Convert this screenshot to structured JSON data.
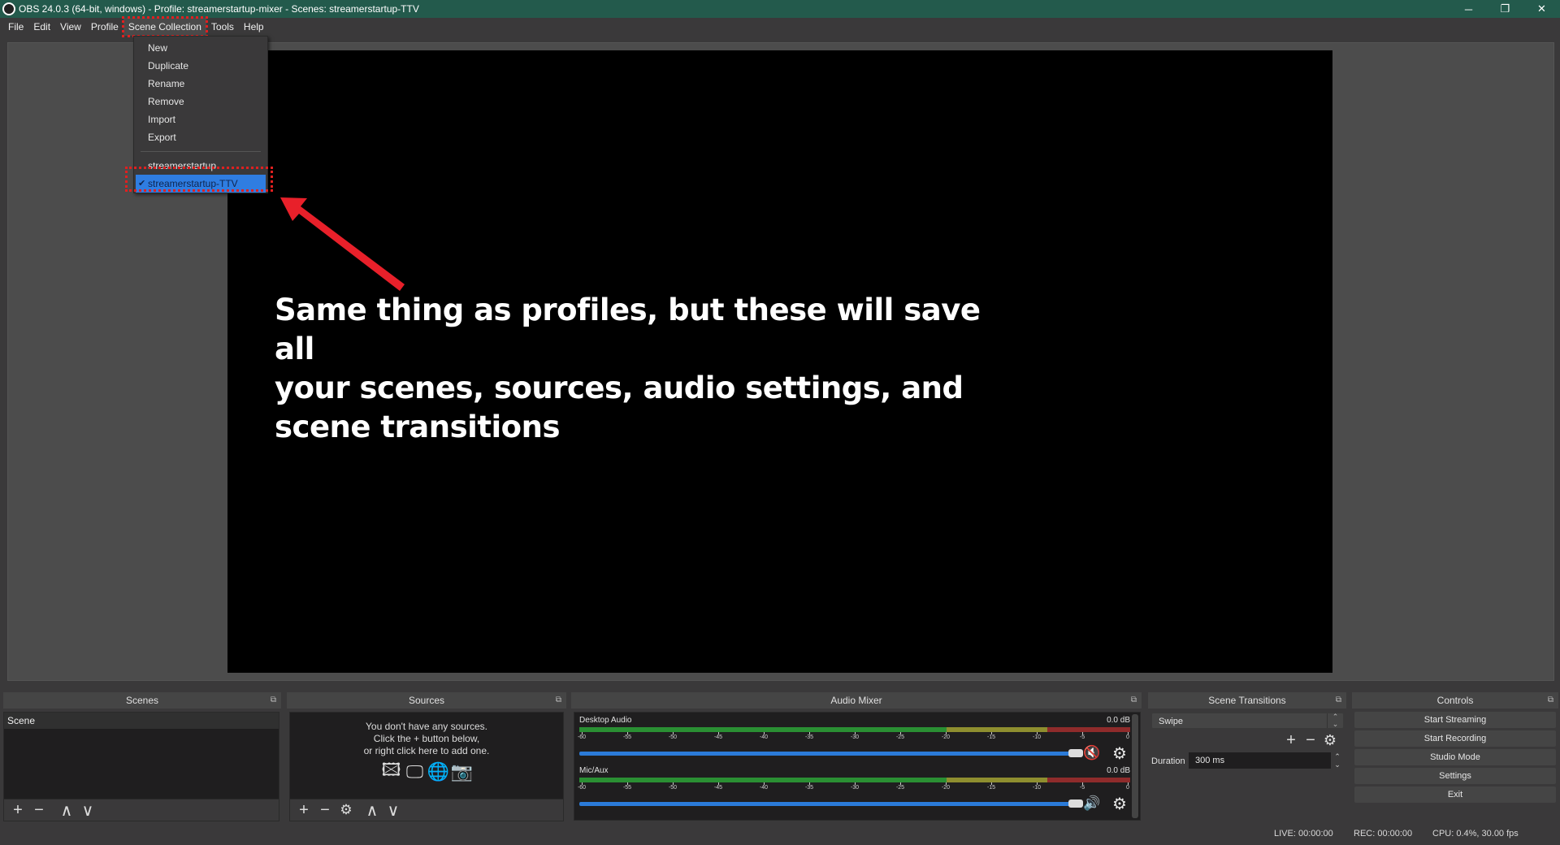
{
  "window": {
    "title": "OBS 24.0.3 (64-bit, windows) - Profile: streamerstartup-mixer - Scenes: streamerstartup-TTV",
    "controls": {
      "minimize": "─",
      "restore": "❐",
      "close": "✕"
    }
  },
  "menubar": {
    "items": [
      "File",
      "Edit",
      "View",
      "Profile",
      "Scene Collection",
      "Tools",
      "Help"
    ],
    "open_item": "Scene Collection"
  },
  "scene_collection_menu": {
    "actions": [
      "New",
      "Duplicate",
      "Rename",
      "Remove",
      "Import",
      "Export"
    ],
    "collections": [
      {
        "label": "streamerstartup",
        "checked": false
      },
      {
        "label": "streamerstartup-TTV",
        "checked": true
      }
    ],
    "check_glyph": "✔"
  },
  "annotation": {
    "lines": [
      "Same thing as profiles, but these will save all",
      "your scenes, sources, audio settings, and",
      "scene transitions"
    ],
    "arrow_color": "#e8202a",
    "highlight_color": "#e02020"
  },
  "docks": {
    "scenes": {
      "title": "Scenes",
      "items": [
        "Scene"
      ],
      "toolbar": {
        "add": "+",
        "remove": "−",
        "up": "∧",
        "down": "∨"
      }
    },
    "sources": {
      "title": "Sources",
      "empty_lines": [
        "You don't have any sources.",
        "Click the + button below,",
        "or right click here to add one."
      ],
      "icons": [
        "image-icon",
        "display-icon",
        "browser-globe-icon",
        "camera-icon"
      ],
      "toolbar": {
        "add": "+",
        "remove": "−",
        "settings": "⚙",
        "up": "∧",
        "down": "∨"
      }
    },
    "audio_mixer": {
      "title": "Audio Mixer",
      "tick_labels": [
        "-60",
        "-55",
        "-50",
        "-45",
        "-40",
        "-35",
        "-30",
        "-25",
        "-20",
        "-15",
        "-10",
        "-5",
        "0"
      ],
      "channels": [
        {
          "name": "Desktop Audio",
          "db": "0.0 dB",
          "muted": true,
          "volume_percent": 100
        },
        {
          "name": "Mic/Aux",
          "db": "0.0 dB",
          "muted": false,
          "volume_percent": 100
        }
      ],
      "colors": {
        "green": "#2a8f33",
        "yellow": "#8e8e2f",
        "red": "#8f2b2b",
        "fader": "#2b7bd8",
        "muted": "#e0161e"
      }
    },
    "scene_transitions": {
      "title": "Scene Transitions",
      "transition": "Swipe",
      "duration_label": "Duration",
      "duration_value": "300 ms"
    },
    "controls": {
      "title": "Controls",
      "buttons": [
        "Start Streaming",
        "Start Recording",
        "Studio Mode",
        "Settings",
        "Exit"
      ]
    }
  },
  "statusbar": {
    "live": "LIVE: 00:00:00",
    "rec": "REC: 00:00:00",
    "cpu": "CPU: 0.4%, 30.00 fps"
  },
  "dock_float_glyph": "⧉"
}
